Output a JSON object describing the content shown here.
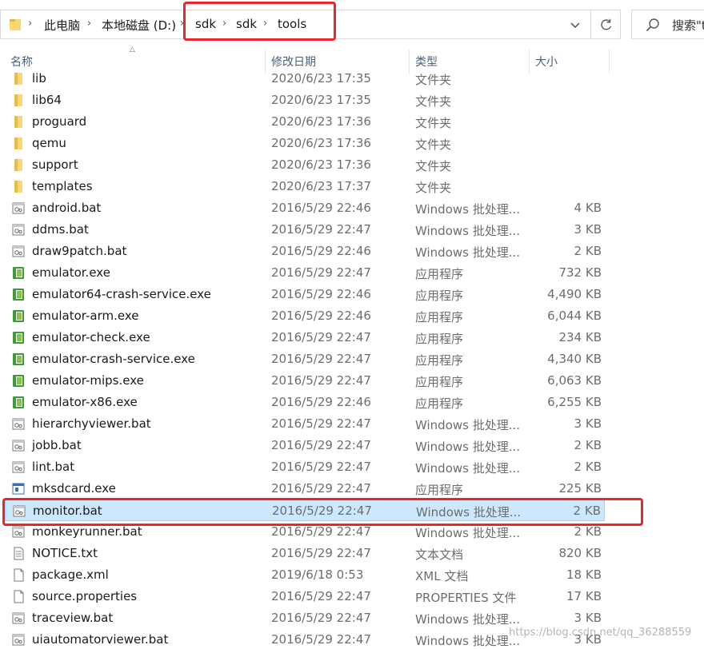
{
  "address_bar": {
    "crumbs": [
      "此电脑",
      "本地磁盘 (D:)",
      "sdk",
      "sdk",
      "tools"
    ],
    "separator": "›"
  },
  "search": {
    "placeholder": "搜索\"to"
  },
  "columns": {
    "name": "名称",
    "date": "修改日期",
    "type": "类型",
    "size": "大小"
  },
  "files": [
    {
      "name": "lib",
      "date": "2020/6/23 17:35",
      "type": "文件夹",
      "size": "",
      "icon": "folder-icon"
    },
    {
      "name": "lib64",
      "date": "2020/6/23 17:35",
      "type": "文件夹",
      "size": "",
      "icon": "folder-icon"
    },
    {
      "name": "proguard",
      "date": "2020/6/23 17:36",
      "type": "文件夹",
      "size": "",
      "icon": "folder-icon"
    },
    {
      "name": "qemu",
      "date": "2020/6/23 17:36",
      "type": "文件夹",
      "size": "",
      "icon": "folder-icon"
    },
    {
      "name": "support",
      "date": "2020/6/23 17:36",
      "type": "文件夹",
      "size": "",
      "icon": "folder-icon"
    },
    {
      "name": "templates",
      "date": "2020/6/23 17:37",
      "type": "文件夹",
      "size": "",
      "icon": "folder-icon"
    },
    {
      "name": "android.bat",
      "date": "2016/5/29 22:46",
      "type": "Windows 批处理...",
      "size": "4 KB",
      "icon": "batch-file-icon"
    },
    {
      "name": "ddms.bat",
      "date": "2016/5/29 22:47",
      "type": "Windows 批处理...",
      "size": "3 KB",
      "icon": "batch-file-icon"
    },
    {
      "name": "draw9patch.bat",
      "date": "2016/5/29 22:46",
      "type": "Windows 批处理...",
      "size": "2 KB",
      "icon": "batch-file-icon"
    },
    {
      "name": "emulator.exe",
      "date": "2016/5/29 22:47",
      "type": "应用程序",
      "size": "732 KB",
      "icon": "emulator-exe-icon"
    },
    {
      "name": "emulator64-crash-service.exe",
      "date": "2016/5/29 22:46",
      "type": "应用程序",
      "size": "4,490 KB",
      "icon": "emulator-exe-icon"
    },
    {
      "name": "emulator-arm.exe",
      "date": "2016/5/29 22:46",
      "type": "应用程序",
      "size": "6,044 KB",
      "icon": "emulator-exe-icon"
    },
    {
      "name": "emulator-check.exe",
      "date": "2016/5/29 22:47",
      "type": "应用程序",
      "size": "234 KB",
      "icon": "emulator-exe-icon"
    },
    {
      "name": "emulator-crash-service.exe",
      "date": "2016/5/29 22:47",
      "type": "应用程序",
      "size": "4,340 KB",
      "icon": "emulator-exe-icon"
    },
    {
      "name": "emulator-mips.exe",
      "date": "2016/5/29 22:47",
      "type": "应用程序",
      "size": "6,063 KB",
      "icon": "emulator-exe-icon"
    },
    {
      "name": "emulator-x86.exe",
      "date": "2016/5/29 22:46",
      "type": "应用程序",
      "size": "6,255 KB",
      "icon": "emulator-exe-icon"
    },
    {
      "name": "hierarchyviewer.bat",
      "date": "2016/5/29 22:47",
      "type": "Windows 批处理...",
      "size": "3 KB",
      "icon": "batch-file-icon"
    },
    {
      "name": "jobb.bat",
      "date": "2016/5/29 22:47",
      "type": "Windows 批处理...",
      "size": "2 KB",
      "icon": "batch-file-icon"
    },
    {
      "name": "lint.bat",
      "date": "2016/5/29 22:47",
      "type": "Windows 批处理...",
      "size": "2 KB",
      "icon": "batch-file-icon"
    },
    {
      "name": "mksdcard.exe",
      "date": "2016/5/29 22:47",
      "type": "应用程序",
      "size": "225 KB",
      "icon": "app-window-icon"
    },
    {
      "name": "monitor.bat",
      "date": "2016/5/29 22:47",
      "type": "Windows 批处理...",
      "size": "2 KB",
      "icon": "batch-file-icon",
      "selected": true
    },
    {
      "name": "monkeyrunner.bat",
      "date": "2016/5/29 22:47",
      "type": "Windows 批处理...",
      "size": "2 KB",
      "icon": "batch-file-icon"
    },
    {
      "name": "NOTICE.txt",
      "date": "2016/5/29 22:47",
      "type": "文本文档",
      "size": "820 KB",
      "icon": "text-file-icon"
    },
    {
      "name": "package.xml",
      "date": "2019/6/18 0:53",
      "type": "XML 文档",
      "size": "18 KB",
      "icon": "blank-file-icon"
    },
    {
      "name": "source.properties",
      "date": "2016/5/29 22:47",
      "type": "PROPERTIES 文件",
      "size": "17 KB",
      "icon": "blank-file-icon"
    },
    {
      "name": "traceview.bat",
      "date": "2016/5/29 22:47",
      "type": "Windows 批处理...",
      "size": "3 KB",
      "icon": "batch-file-icon"
    },
    {
      "name": "uiautomatorviewer.bat",
      "date": "2016/5/29 22:47",
      "type": "Windows 批处理...",
      "size": "3 KB",
      "icon": "batch-file-icon"
    }
  ],
  "watermark": "https://blog.csdn.net/qq_36288559",
  "colors": {
    "selection": "#cce8ff",
    "selection_border": "#99d1ff",
    "annotation": "#e8262b",
    "folder": "#f8d775"
  }
}
